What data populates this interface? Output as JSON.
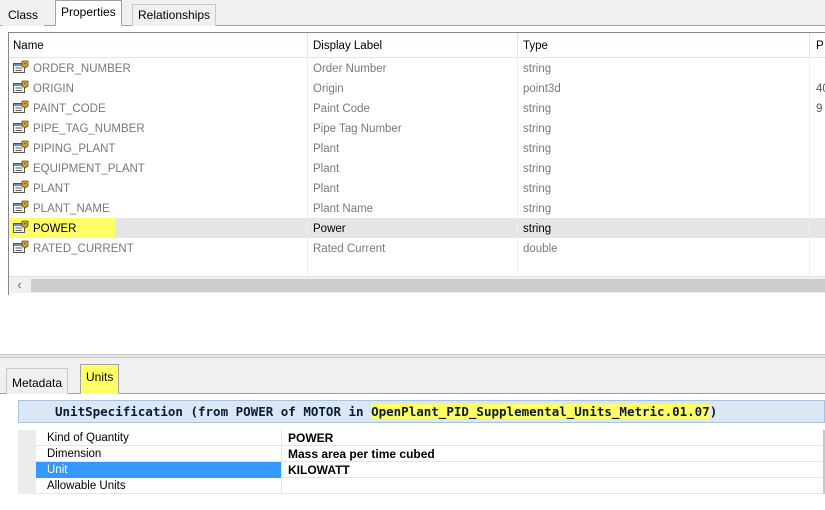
{
  "top_tabs": [
    "Class",
    "Properties",
    "Relationships"
  ],
  "columns": {
    "name": "Name",
    "display_label": "Display Label",
    "type": "Type",
    "extra": "P"
  },
  "properties": [
    {
      "name": "ORDER_NUMBER",
      "label": "Order Number",
      "type": "string",
      "extra": ""
    },
    {
      "name": "ORIGIN",
      "label": "Origin",
      "type": "point3d",
      "extra": "40"
    },
    {
      "name": "PAINT_CODE",
      "label": "Paint Code",
      "type": "string",
      "extra": "9"
    },
    {
      "name": "PIPE_TAG_NUMBER",
      "label": "Pipe Tag Number",
      "type": "string",
      "extra": ""
    },
    {
      "name": "PIPING_PLANT",
      "label": "Plant",
      "type": "string",
      "extra": ""
    },
    {
      "name": "EQUIPMENT_PLANT",
      "label": "Plant",
      "type": "string",
      "extra": ""
    },
    {
      "name": "PLANT",
      "label": "Plant",
      "type": "string",
      "extra": ""
    },
    {
      "name": "PLANT_NAME",
      "label": "Plant Name",
      "type": "string",
      "extra": ""
    },
    {
      "name": "POWER",
      "label": "Power",
      "type": "string",
      "extra": ""
    },
    {
      "name": "RATED_CURRENT",
      "label": "Rated Current",
      "type": "double",
      "extra": ""
    }
  ],
  "selected_property": "POWER",
  "scroll_left_glyph": "‹",
  "bottom_tabs": [
    "Metadata",
    "Units"
  ],
  "unit_spec": {
    "title_prefix": "UnitSpecification (from POWER of MOTOR in ",
    "title_highlight": "OpenPlant_PID_Supplemental_Units_Metric.01.07",
    "title_suffix": ")"
  },
  "unit_rows": [
    {
      "key": "Kind of Quantity",
      "value": "POWER"
    },
    {
      "key": "Dimension",
      "value": "Mass area per time cubed"
    },
    {
      "key": "Unit",
      "value": "KILOWATT"
    },
    {
      "key": "Allowable Units",
      "value": ""
    }
  ],
  "selected_unit_row": "Unit",
  "colors": {
    "highlight": "#ffff66",
    "selection": "#3399ff",
    "header_band": "#dbe7f5"
  },
  "icons": {
    "property": "property-sheet-icon",
    "scroll_left": "chevron-left-icon"
  }
}
